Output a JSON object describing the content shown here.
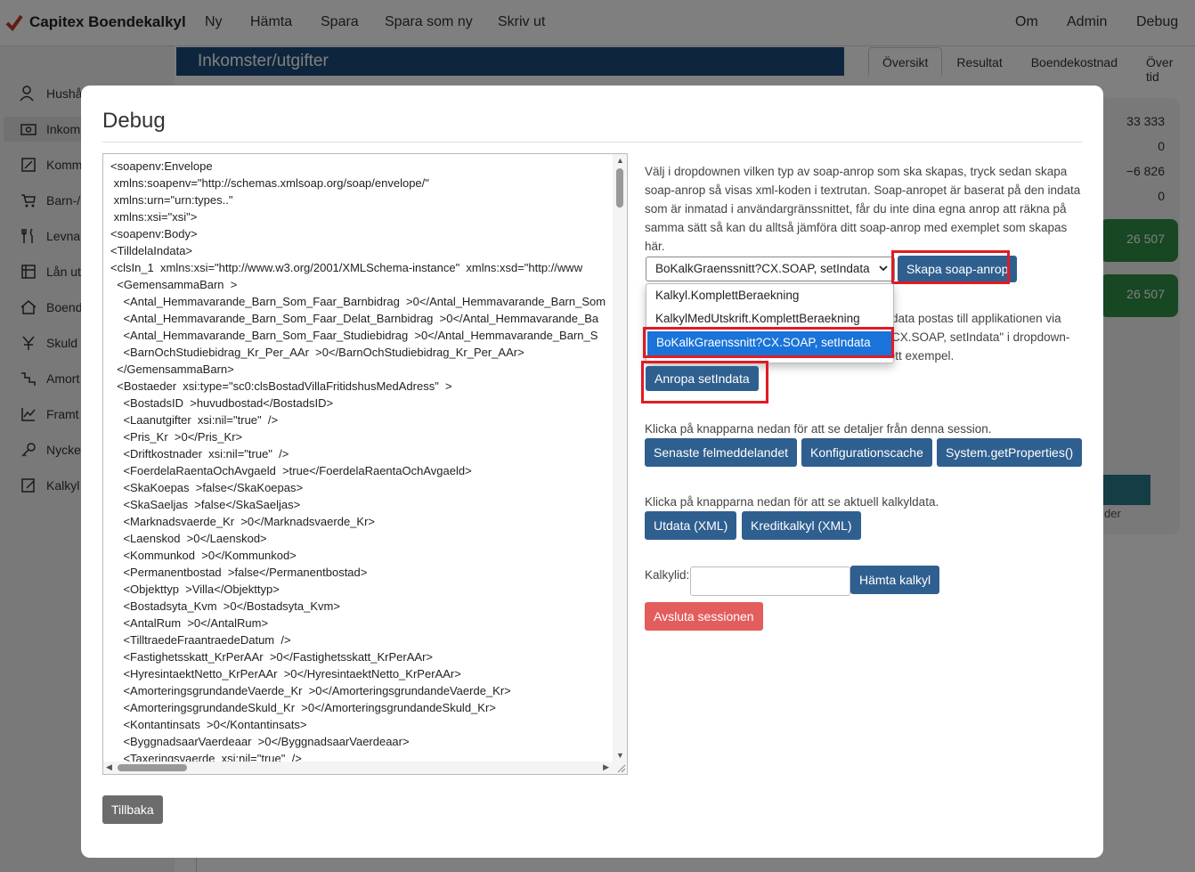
{
  "app": {
    "brand": "Capitex Boendekalkyl",
    "nav": [
      "Ny",
      "Hämta",
      "Spara",
      "Spara som ny",
      "Skriv ut"
    ],
    "nav_right": [
      "Om",
      "Admin",
      "Debug"
    ],
    "sidebar": [
      "Hushå",
      "Inkom",
      "Komm",
      "Barn-/",
      "Levna",
      "Lån ut",
      "Boend",
      "Skuld",
      "Amort",
      "Framt",
      "Nycke",
      "Kalkyl"
    ],
    "main_header": "Inkomster/utgifter",
    "tabs": [
      "Översikt",
      "Resultat",
      "Boendekostnad",
      "Över tid"
    ],
    "right_values": [
      "33 333",
      "0",
      "−6 826",
      "0"
    ],
    "green_values": [
      "26 507",
      "26 507"
    ],
    "right_text": "der",
    "colors": {
      "header": "#1c4d7a",
      "green": "#2f8f46",
      "button": "#2f5f8f",
      "danger": "#e35d5d",
      "highlight": "#1a73d9",
      "frame": "#e01b24"
    }
  },
  "modal": {
    "title": "Debug",
    "xml": "<soapenv:Envelope\n xmlns:soapenv=\"http://schemas.xmlsoap.org/soap/envelope/\"\n xmlns:urn=\"urn:types..\"\n xmlns:xsi=\"xsi\">\n<soapenv:Body>\n<TilldelaIndata>\n<clsIn_1  xmlns:xsi=\"http://www.w3.org/2001/XMLSchema-instance\"  xmlns:xsd=\"http://www\n  <GemensammaBarn  >\n    <Antal_Hemmavarande_Barn_Som_Faar_Barnbidrag  >0</Antal_Hemmavarande_Barn_Som\n    <Antal_Hemmavarande_Barn_Som_Faar_Delat_Barnbidrag  >0</Antal_Hemmavarande_Ba\n    <Antal_Hemmavarande_Barn_Som_Faar_Studiebidrag  >0</Antal_Hemmavarande_Barn_S\n    <BarnOchStudiebidrag_Kr_Per_AAr  >0</BarnOchStudiebidrag_Kr_Per_AAr>\n  </GemensammaBarn>\n  <Bostaeder  xsi:type=\"sc0:clsBostadVillaFritidshusMedAdress\"  >\n    <BostadsID  >huvudbostad</BostadsID>\n    <Laanutgifter  xsi:nil=\"true\"  />\n    <Pris_Kr  >0</Pris_Kr>\n    <Driftkostnader  xsi:nil=\"true\"  />\n    <FoerdelaRaentaOchAvgaeld  >true</FoerdelaRaentaOchAvgaeld>\n    <SkaKoepas  >false</SkaKoepas>\n    <SkaSaeljas  >false</SkaSaeljas>\n    <Marknadsvaerde_Kr  >0</Marknadsvaerde_Kr>\n    <Laenskod  >0</Laenskod>\n    <Kommunkod  >0</Kommunkod>\n    <Permanentbostad  >false</Permanentbostad>\n    <Objekttyp  >Villa</Objekttyp>\n    <Bostadsyta_Kvm  >0</Bostadsyta_Kvm>\n    <AntalRum  >0</AntalRum>\n    <TilltraedeFraantraedeDatum  />\n    <Fastighetsskatt_KrPerAAr  >0</Fastighetsskatt_KrPerAAr>\n    <HyresintaektNetto_KrPerAAr  >0</HyresintaektNetto_KrPerAAr>\n    <AmorteringsgrundandeVaerde_Kr  >0</AmorteringsgrundandeVaerde_Kr>\n    <AmorteringsgrundandeSkuld_Kr  >0</AmorteringsgrundandeSkuld_Kr>\n    <Kontantinsats  >0</Kontantinsats>\n    <ByggnadsaarVaerdeaar  >0</ByggnadsaarVaerdeaar>\n    <Taxeringsvaerde  xsi:nil=\"true\"  />",
    "description": "Välj i dropdownen vilken typ av soap-anrop som ska skapas, tryck sedan skapa soap-anrop så visas xml-koden i textrutan. Soap-anropet är baserat på den indata som är inmatad i användargränssnittet, får du inte dina egna anrop att räkna på samma sätt så kan du alltså jämföra ditt soap-anrop med exemplet som skapas här.",
    "select_value": "BoKalkGraenssnitt?CX.SOAP, setIndata",
    "dropdown_options": [
      "Kalkyl.KomplettBeraekning",
      "KalkylMedUtskrift.KomplettBeraekning",
      "BoKalkGraenssnitt?CX.SOAP, setIndata"
    ],
    "create_button": "Skapa soap-anrop",
    "partial_text": [
      "data postas till applikationen via",
      "CX.SOAP, setIndata\" i dropdown-",
      "listan ovan och \"Skapa soap-anrop\" för att se ett exempel."
    ],
    "call_button": "Anropa setIndata",
    "session_text": "Klicka på knapparna nedan för att se detaljer från denna session.",
    "session_buttons": [
      "Senaste felmeddelandet",
      "Konfigurationscache",
      "System.getProperties()"
    ],
    "calc_text": "Klicka på knapparna nedan för att se aktuell kalkyldata.",
    "calc_buttons": [
      "Utdata (XML)",
      "Kreditkalkyl (XML)"
    ],
    "kalkylid_label": "Kalkylid:",
    "kalkylid_value": "",
    "fetch_button": "Hämta kalkyl",
    "end_button": "Avsluta sessionen",
    "back_button": "Tillbaka"
  }
}
